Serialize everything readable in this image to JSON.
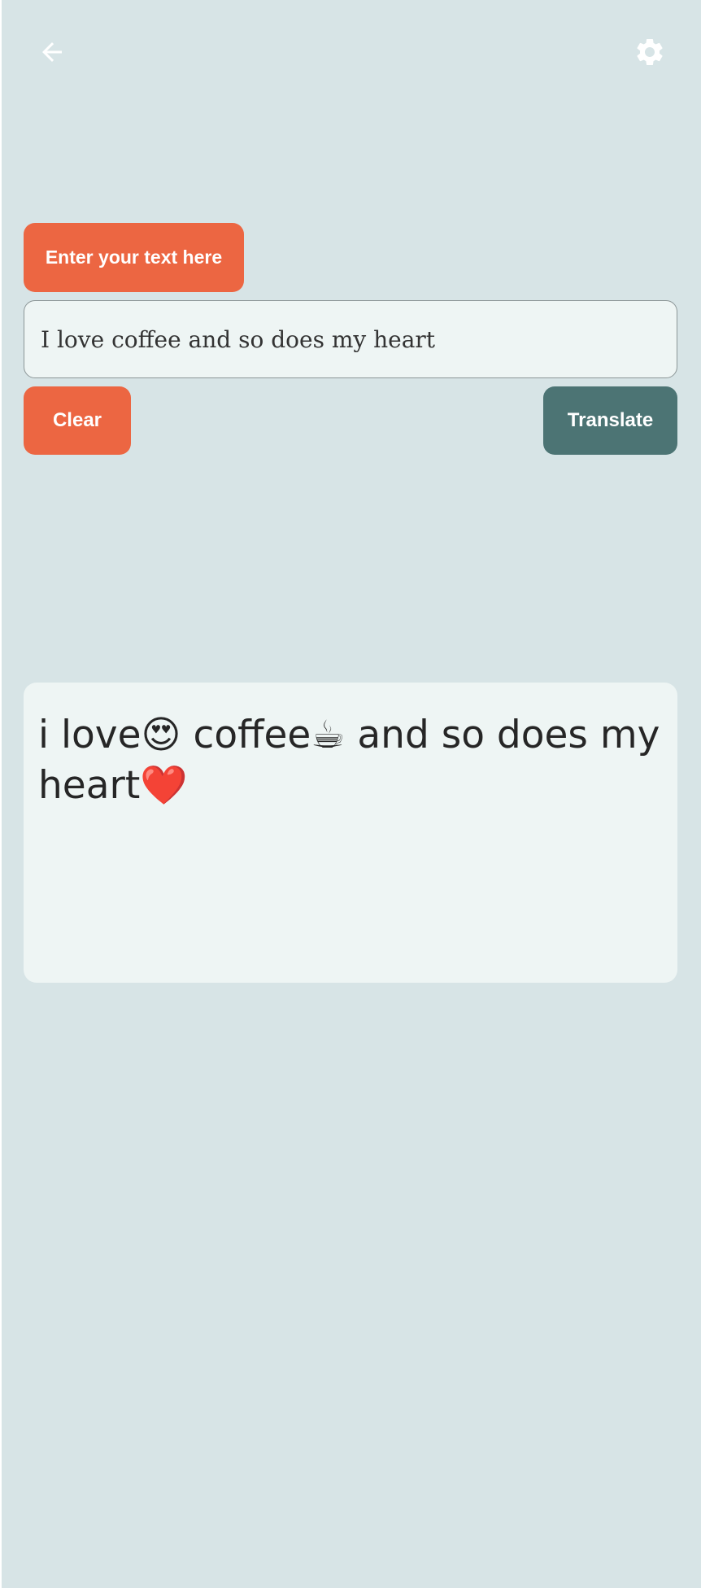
{
  "header": {
    "back_icon": "arrow-left-icon",
    "settings_icon": "gear-icon"
  },
  "input": {
    "prompt_label": "Enter your text here",
    "value": "I love coffee and so does my heart"
  },
  "actions": {
    "clear_label": "Clear",
    "translate_label": "Translate"
  },
  "output": {
    "text": "i love😍 coffee☕ and so does my heart❤️"
  },
  "colors": {
    "background": "#d7e4e6",
    "accent_orange": "#ec6642",
    "accent_teal": "#4c7474",
    "card": "#eef5f4"
  }
}
